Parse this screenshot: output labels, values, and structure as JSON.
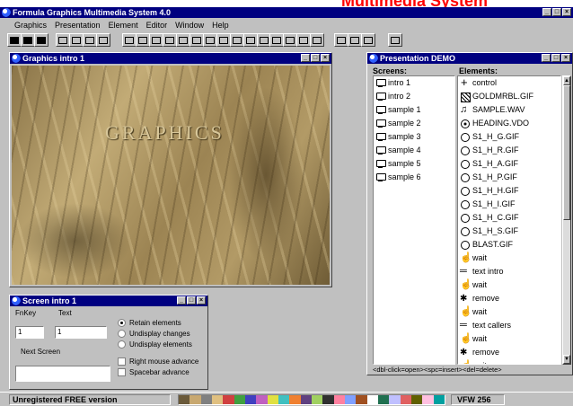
{
  "banner": {
    "text": "Multimedia System"
  },
  "app": {
    "title": "Formula Graphics Multimedia System 4.0",
    "controls": [
      "_",
      "□",
      "×"
    ]
  },
  "menu": [
    {
      "label": "Graphics"
    },
    {
      "label": "Presentation"
    },
    {
      "label": "Element"
    },
    {
      "label": "Editor"
    },
    {
      "label": "Window"
    },
    {
      "label": "Help"
    }
  ],
  "graphics_window": {
    "title": "Graphics intro 1",
    "image_text": "GRAPHICS"
  },
  "screen_window": {
    "title": "Screen intro 1",
    "fnkey_label": "FnKey",
    "fnkey_value": "1",
    "text_label": "Text",
    "text_value": "1",
    "next_label": "Next Screen",
    "next_value": "",
    "options": [
      {
        "label": "Retain elements",
        "type": "radio",
        "checked": true
      },
      {
        "label": "Undisplay changes",
        "type": "radio",
        "checked": false
      },
      {
        "label": "Undisplay elements",
        "type": "radio",
        "checked": false
      },
      {
        "label": "Right mouse advance",
        "type": "check",
        "checked": false
      },
      {
        "label": "Spacebar advance",
        "type": "check",
        "checked": false
      }
    ]
  },
  "presentation_window": {
    "title": "Presentation DEMO",
    "screens_header": "Screens:",
    "elements_header": "Elements:",
    "screens": [
      "intro 1",
      "intro 2",
      "sample 1",
      "sample 2",
      "sample 3",
      "sample 4",
      "sample 5",
      "sample 6"
    ],
    "elements": [
      {
        "icon": "control",
        "label": "control"
      },
      {
        "icon": "box",
        "label": "GOLDMRBL.GIF"
      },
      {
        "icon": "note",
        "label": "SAMPLE.WAV"
      },
      {
        "icon": "film",
        "label": "HEADING.VDO"
      },
      {
        "icon": "circle",
        "label": "S1_H_G.GIF"
      },
      {
        "icon": "circle",
        "label": "S1_H_R.GIF"
      },
      {
        "icon": "circle",
        "label": "S1_H_A.GIF"
      },
      {
        "icon": "circle",
        "label": "S1_H_P.GIF"
      },
      {
        "icon": "circle",
        "label": "S1_H_H.GIF"
      },
      {
        "icon": "circle",
        "label": "S1_H_I.GIF"
      },
      {
        "icon": "circle",
        "label": "S1_H_C.GIF"
      },
      {
        "icon": "circle",
        "label": "S1_H_S.GIF"
      },
      {
        "icon": "circle",
        "label": "BLAST.GIF"
      },
      {
        "icon": "hand",
        "label": "wait"
      },
      {
        "icon": "text",
        "label": "text intro"
      },
      {
        "icon": "hand",
        "label": "wait"
      },
      {
        "icon": "remove",
        "label": "remove"
      },
      {
        "icon": "hand",
        "label": "wait"
      },
      {
        "icon": "text",
        "label": "text callers"
      },
      {
        "icon": "hand",
        "label": "wait"
      },
      {
        "icon": "remove",
        "label": "remove"
      },
      {
        "icon": "hand",
        "label": "wait"
      }
    ],
    "footer": "<dbl-click=open><spc=insert><del=delete>"
  },
  "status": {
    "left": "Unregistered FREE version",
    "right": "VFW 256"
  },
  "palette": [
    "#6b5a3a",
    "#c8a870",
    "#808080",
    "#e0c080",
    "#d04040",
    "#40a040",
    "#4040c0",
    "#c060c0",
    "#e0e040",
    "#40c0c0",
    "#f08030",
    "#604080",
    "#a0d060",
    "#303030",
    "#ff80a0",
    "#80a0ff",
    "#a05020",
    "#ffffff",
    "#207050",
    "#c0c0ff",
    "#e06060",
    "#606000",
    "#ffc0e0",
    "#00a0a0"
  ],
  "colors": {
    "title_blue": "#000080",
    "banner_red": "#ff0000"
  }
}
